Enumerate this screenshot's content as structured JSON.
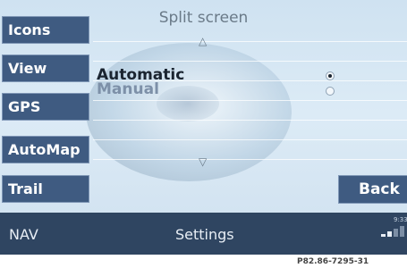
{
  "sidebar": {
    "items": [
      {
        "label": "Icons"
      },
      {
        "label": "View"
      },
      {
        "label": "GPS"
      },
      {
        "label": "AutoMap"
      },
      {
        "label": "Trail"
      }
    ]
  },
  "panel": {
    "title": "Split screen",
    "up_arrow": "△",
    "down_arrow": "▽",
    "options": [
      {
        "label": "Automatic",
        "selected": true,
        "color": "#1a2430"
      },
      {
        "label": "Manual",
        "selected": false,
        "color": "#7d90a8"
      }
    ],
    "back_label": "Back"
  },
  "statusbar": {
    "nav_label": "NAV",
    "title": "Settings",
    "time": "9:33"
  },
  "caption": "P82.86-7295-31",
  "colors": {
    "button_bg": "#3f5b81",
    "statusbar_bg": "#2f4561",
    "screen_bg": "#d6e7f4"
  }
}
